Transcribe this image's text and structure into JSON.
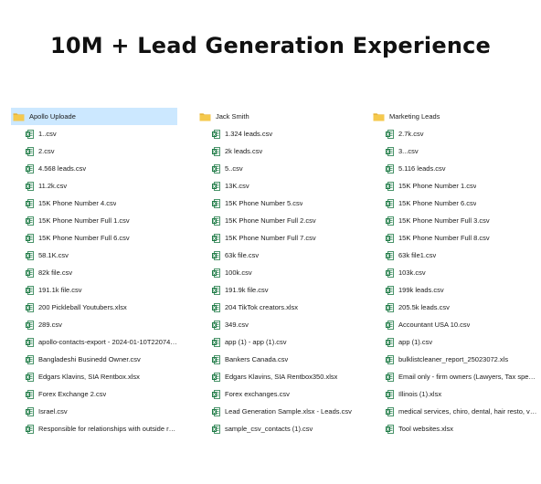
{
  "headline": "10M + Lead Generation Experience",
  "columns": [
    {
      "folder": "Apollo Uploade",
      "selected": true,
      "files": [
        "1..csv",
        "2.csv",
        "4.568 leads.csv",
        "11.2k.csv",
        "15K Phone Number 4.csv",
        "15K Phone Number Full 1.csv",
        "15K Phone Number Full 6.csv",
        "58.1K.csv",
        "82k file.csv",
        "191.1k file.csv",
        "200 Pickleball Youtubers.xlsx",
        "289.csv",
        "apollo-contacts-export - 2024-01-10T220742.8...",
        "Bangladeshi Businedd Owner.csv",
        "Edgars Klavins, SIA Rentbox.xlsx",
        "Forex Exchange 2.csv",
        "Israel.csv",
        "Responsible for relationships with outside recr..."
      ]
    },
    {
      "folder": "Jack Smith",
      "selected": false,
      "files": [
        "1.324 leads.csv",
        "2k leads.csv",
        "5..csv",
        "13K.csv",
        "15K Phone Number 5.csv",
        "15K Phone Number Full 2.csv",
        "15K Phone Number Full 7.csv",
        "63k file.csv",
        "100k.csv",
        "191.9k file.csv",
        "204 TikTok creators.xlsx",
        "349.csv",
        "app (1) - app (1).csv",
        "Bankers Canada.csv",
        "Edgars Klavins, SIA Rentbox350.xlsx",
        "Forex exchanges.csv",
        "Lead Generation Sample.xlsx - Leads.csv",
        "sample_csv_contacts (1).csv"
      ]
    },
    {
      "folder": "Marketing Leads",
      "selected": false,
      "files": [
        "2.7k.csv",
        "3...csv",
        "5.116 leads.csv",
        "15K Phone Number 1.csv",
        "15K Phone Number 6.csv",
        "15K Phone Number Full 3.csv",
        "15K Phone Number Full 8.csv",
        "63k file1.csv",
        "103k.csv",
        "199k leads.csv",
        "205.5k leads.csv",
        "Accountant USA 10.csv",
        "app (1).csv",
        "bulklistcleaner_report_25023072.xls",
        "Email only - firm owners (Lawyers, Tax speciali...",
        "Illinois (1).xlsx",
        "medical services, chiro, dental, hair resto, vari...",
        "Tool websites.xlsx"
      ]
    }
  ],
  "icons": {
    "folder": "folder-icon",
    "file": "excel-file-icon"
  },
  "colors": {
    "folder_fill": "#f5c94d",
    "folder_tab": "#e8b53a",
    "excel_green": "#1d7a45",
    "selection": "#cce8ff"
  }
}
